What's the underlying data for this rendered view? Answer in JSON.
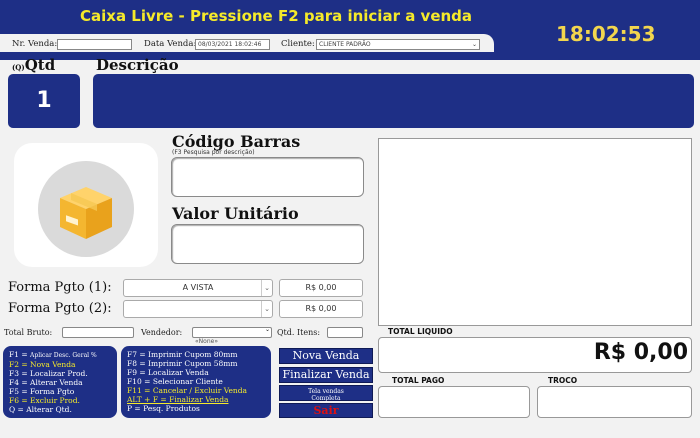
{
  "header": {
    "title": "Caixa Livre - Pressione F2 para iniciar a venda",
    "clock": "18:02:53"
  },
  "info_bar": {
    "nr_venda_label": "Nr. Venda:",
    "nr_venda_value": "",
    "data_venda_label": "Data Venda:",
    "data_venda_value": "08/03/2021 18:02:46",
    "cliente_label": "Cliente:",
    "cliente_value": "CLIENTE PADRÃO"
  },
  "item": {
    "qtd_hotkey": "(Q)",
    "qtd_label": "Qtd",
    "qtd_value": "1",
    "descricao_label": "Descrição",
    "descricao_value": ""
  },
  "fields": {
    "codigo_barras_label": "Código Barras",
    "codigo_barras_hint": "(F3 Pesquisa por descrição)",
    "codigo_barras_value": "",
    "valor_unitario_label": "Valor Unitário",
    "valor_unitario_value": ""
  },
  "payment": {
    "forma1_label": "Forma Pgto (1):",
    "forma1_value": "A VISTA",
    "forma1_amount": "R$ 0,00",
    "forma2_label": "Forma Pgto (2):",
    "forma2_value": "",
    "forma2_amount": "R$ 0,00"
  },
  "bottom_row": {
    "total_bruto_label": "Total Bruto:",
    "vendedor_label": "Vendedor:",
    "vendedor_value": "«None»",
    "qtd_itens_label": "Qtd. Itens:"
  },
  "totals": {
    "total_liquido_label": "TOTAL LIQUIDO",
    "total_liquido_value": "R$ 0,00",
    "total_pago_label": "TOTAL PAGO",
    "troco_label": "TROCO"
  },
  "shortcuts_left": [
    {
      "key": "F1",
      "text": "Aplicar Desc. Geral %",
      "style": "small"
    },
    {
      "key": "F2",
      "text": "Nova Venda",
      "style": "highlight"
    },
    {
      "key": "F3",
      "text": "Localizar Prod.",
      "style": "normal"
    },
    {
      "key": "F4",
      "text": "Alterar Venda",
      "style": "normal"
    },
    {
      "key": "F5",
      "text": "Forma Pgto",
      "style": "normal"
    },
    {
      "key": "F6",
      "text": "Excluir Prod.",
      "style": "highlight"
    },
    {
      "key": "Q",
      "text": "Alterar Qtd.",
      "style": "normal"
    }
  ],
  "shortcuts_right": [
    {
      "key": "F7",
      "text": "Imprimir Cupom 80mm",
      "style": "normal"
    },
    {
      "key": "F8",
      "text": "Imprimir Cupom 58mm",
      "style": "normal"
    },
    {
      "key": "F9",
      "text": "Localizar Venda",
      "style": "normal"
    },
    {
      "key": "F10",
      "text": "Selecionar Cliente",
      "style": "normal"
    },
    {
      "key": "F11",
      "text": "Cancelar / Excluir Venda",
      "style": "highlight"
    },
    {
      "key": "ALT + F",
      "text": "Finalizar Venda",
      "style": "underline"
    },
    {
      "key": "P",
      "text": "Pesq. Produtos",
      "style": "normal"
    }
  ],
  "buttons": {
    "nova_venda": "Nova Venda",
    "finalizar_venda": "Finalizar Venda",
    "tela_vendas_1": "Tela vendas",
    "tela_vendas_2": "Completa",
    "sair": "Sair"
  },
  "colors": {
    "brand_blue": "#1e2f86",
    "title_yellow": "#f5ea2a",
    "danger_red": "#dd1111"
  }
}
